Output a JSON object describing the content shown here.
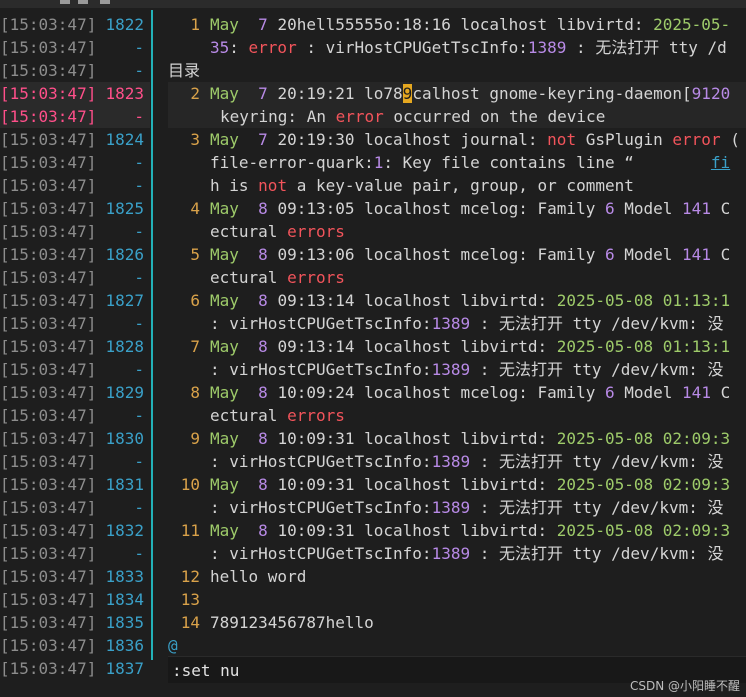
{
  "gutter": {
    "rows": [
      {
        "ts": "[15:03:47]",
        "ln": "1822",
        "hl": false
      },
      {
        "ts": "[15:03:47]",
        "ln": "-",
        "hl": false
      },
      {
        "ts": "[15:03:47]",
        "ln": "-",
        "hl": false
      },
      {
        "ts": "[15:03:47]",
        "ln": "1823",
        "hl": true
      },
      {
        "ts": "[15:03:47]",
        "ln": "-",
        "hl": true
      },
      {
        "ts": "[15:03:47]",
        "ln": "1824",
        "hl": false
      },
      {
        "ts": "[15:03:47]",
        "ln": "-",
        "hl": false
      },
      {
        "ts": "[15:03:47]",
        "ln": "-",
        "hl": false
      },
      {
        "ts": "[15:03:47]",
        "ln": "1825",
        "hl": false
      },
      {
        "ts": "[15:03:47]",
        "ln": "-",
        "hl": false
      },
      {
        "ts": "[15:03:47]",
        "ln": "1826",
        "hl": false
      },
      {
        "ts": "[15:03:47]",
        "ln": "-",
        "hl": false
      },
      {
        "ts": "[15:03:47]",
        "ln": "1827",
        "hl": false
      },
      {
        "ts": "[15:03:47]",
        "ln": "-",
        "hl": false
      },
      {
        "ts": "[15:03:47]",
        "ln": "1828",
        "hl": false
      },
      {
        "ts": "[15:03:47]",
        "ln": "-",
        "hl": false
      },
      {
        "ts": "[15:03:47]",
        "ln": "1829",
        "hl": false
      },
      {
        "ts": "[15:03:47]",
        "ln": "-",
        "hl": false
      },
      {
        "ts": "[15:03:47]",
        "ln": "1830",
        "hl": false
      },
      {
        "ts": "[15:03:47]",
        "ln": "-",
        "hl": false
      },
      {
        "ts": "[15:03:47]",
        "ln": "1831",
        "hl": false
      },
      {
        "ts": "[15:03:47]",
        "ln": "-",
        "hl": false
      },
      {
        "ts": "[15:03:47]",
        "ln": "1832",
        "hl": false
      },
      {
        "ts": "[15:03:47]",
        "ln": "-",
        "hl": false
      },
      {
        "ts": "[15:03:47]",
        "ln": "1833",
        "hl": false
      },
      {
        "ts": "[15:03:47]",
        "ln": "1834",
        "hl": false
      },
      {
        "ts": "[15:03:47]",
        "ln": "1835",
        "hl": false
      },
      {
        "ts": "[15:03:47]",
        "ln": "1836",
        "hl": false
      },
      {
        "ts": "[15:03:47]",
        "ln": "1837",
        "hl": false
      }
    ]
  },
  "editor": {
    "l1": {
      "num": "1",
      "a": "May  ",
      "b": "7",
      "c": " 20hell55555o:18:16 localhost libvirtd: ",
      "d": "2025-05-"
    },
    "l1w": {
      "a": "35",
      "b": ": ",
      "c": "error",
      "d": " : virHostCPUGetTscInfo:",
      "e": "1389",
      "f": " : 无法打开 tty /d"
    },
    "dir": "目录",
    "l2": {
      "num": "2",
      "a": "May  ",
      "b": "7",
      "c": " 20:19:21 lo78",
      "cur": "9",
      "d": "calhost gnome-keyring-daemon[",
      "e": "9120"
    },
    "l2w": {
      "a": "keyring: An ",
      "b": "error",
      "c": " occurred on the device"
    },
    "l3": {
      "num": "3",
      "a": "May  ",
      "b": "7",
      "c": " 20:19:30 localhost journal: ",
      "d": "not",
      "e": " GsPlugin ",
      "f": "error",
      "g": " ("
    },
    "l3w": {
      "a": "file-error-quark:",
      "b": "1",
      "c": ": Key file contains line “        ",
      "d": "fi"
    },
    "l3w2": {
      "a": "h is ",
      "b": "not",
      "c": " a key-value pair, group, or comment"
    },
    "l4": {
      "num": "4",
      "a": "May  ",
      "b": "8",
      "c": " 09:13:05 localhost mcelog: Family ",
      "d": "6",
      "e": " Model ",
      "f": "141",
      "g": " C"
    },
    "l4w": {
      "a": "ectural ",
      "b": "errors"
    },
    "l5": {
      "num": "5",
      "a": "May  ",
      "b": "8",
      "c": " 09:13:06 localhost mcelog: Family ",
      "d": "6",
      "e": " Model ",
      "f": "141",
      "g": " C"
    },
    "l5w": {
      "a": "ectural ",
      "b": "errors"
    },
    "l6": {
      "num": "6",
      "a": "May  ",
      "b": "8",
      "c": " 09:13:14 localhost libvirtd: ",
      "d": "2025-05-08 01:13:1"
    },
    "l6w": {
      "a": ": virHostCPUGetTscInfo:",
      "b": "1389",
      "c": " : 无法打开 tty /dev/kvm: 没"
    },
    "l7": {
      "num": "7",
      "a": "May  ",
      "b": "8",
      "c": " 09:13:14 localhost libvirtd: ",
      "d": "2025-05-08 01:13:1"
    },
    "l7w": {
      "a": ": virHostCPUGetTscInfo:",
      "b": "1389",
      "c": " : 无法打开 tty /dev/kvm: 没"
    },
    "l8": {
      "num": "8",
      "a": "May  ",
      "b": "8",
      "c": " 10:09:24 localhost mcelog: Family ",
      "d": "6",
      "e": " Model ",
      "f": "141",
      "g": " C"
    },
    "l8w": {
      "a": "ectural ",
      "b": "errors"
    },
    "l9": {
      "num": "9",
      "a": "May  ",
      "b": "8",
      "c": " 10:09:31 localhost libvirtd: ",
      "d": "2025-05-08 02:09:3"
    },
    "l9w": {
      "a": ": virHostCPUGetTscInfo:",
      "b": "1389",
      "c": " : 无法打开 tty /dev/kvm: 没"
    },
    "l10": {
      "num": "10",
      "a": "May  ",
      "b": "8",
      "c": " 10:09:31 localhost libvirtd: ",
      "d": "2025-05-08 02:09:3"
    },
    "l10w": {
      "a": ": virHostCPUGetTscInfo:",
      "b": "1389",
      "c": " : 无法打开 tty /dev/kvm: 没"
    },
    "l11": {
      "num": "11",
      "a": "May  ",
      "b": "8",
      "c": " 10:09:31 localhost libvirtd: ",
      "d": "2025-05-08 02:09:3"
    },
    "l11w": {
      "a": ": virHostCPUGetTscInfo:",
      "b": "1389",
      "c": " : 无法打开 tty /dev/kvm: 没"
    },
    "l12": {
      "num": "12",
      "text": "hello word"
    },
    "l13": {
      "num": "13",
      "text": ""
    },
    "l14": {
      "num": "14",
      "text": "789123456787hello"
    },
    "end_marker": "@"
  },
  "command": ":set nu",
  "watermark": "CSDN @小阳睡不醒"
}
